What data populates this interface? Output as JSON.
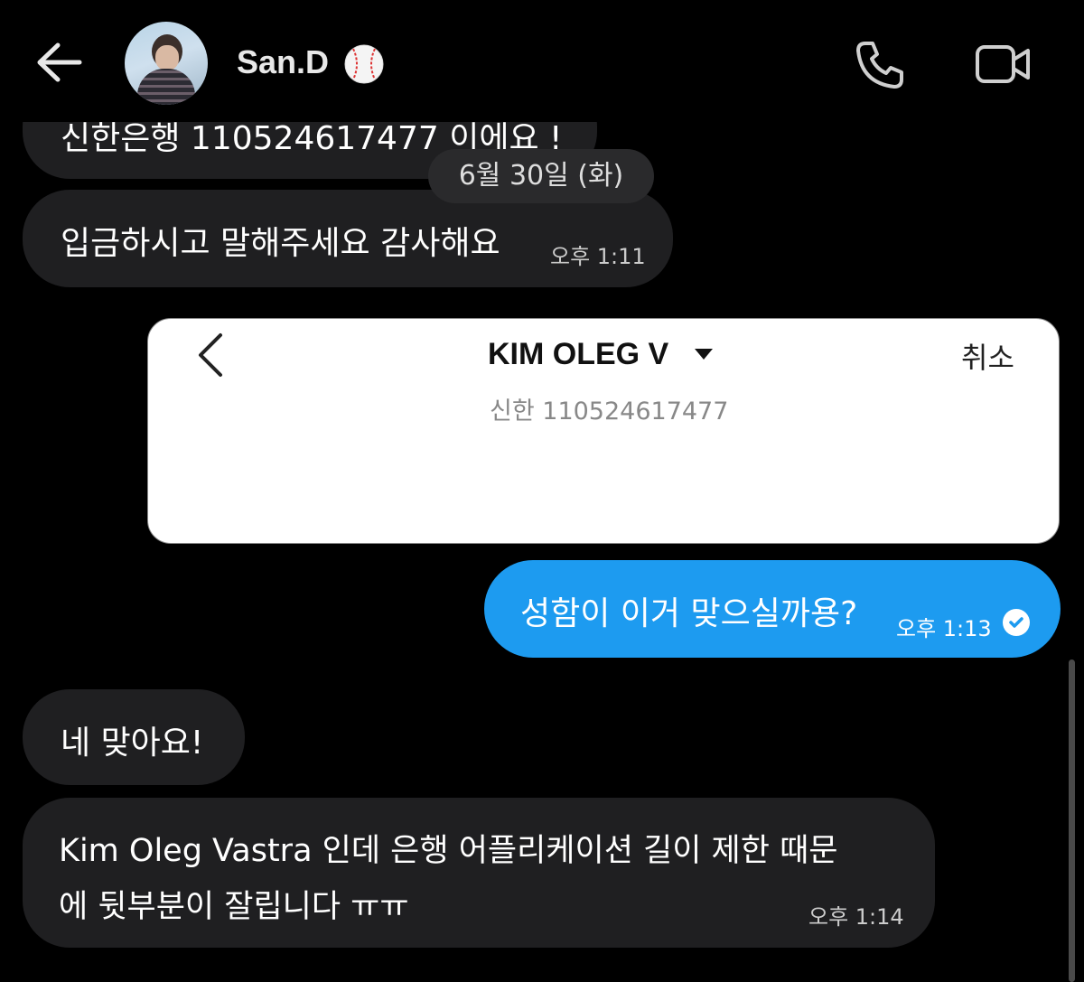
{
  "header": {
    "contact_name": "San.D",
    "icons": [
      "back-arrow-icon",
      "baseball-emoji-icon",
      "phone-icon",
      "video-icon"
    ]
  },
  "messages": [
    {
      "id": "m0",
      "direction": "in",
      "text": "신한은행 110524617477 이에요 !",
      "time": ""
    },
    {
      "id": "m1",
      "direction": "in",
      "text": "입금하시고 말해주세요 감사해요",
      "time": "오후 1:11"
    },
    {
      "id": "m2",
      "direction": "out",
      "text": "성함이 이거 맞으실까용?",
      "time": "오후 1:13",
      "read": true
    },
    {
      "id": "m3",
      "direction": "in",
      "text": "네 맞아요!",
      "time": ""
    },
    {
      "id": "m4",
      "direction": "in",
      "line1": "Kim Oleg Vastra 인데 은행 어플리케이션 길이 제한 때문",
      "line2": "에 뒷부분이 잘립니다 ㅠㅠ",
      "time": "오후 1:14"
    }
  ],
  "date_separator": "6월 30일 (화)",
  "transfer_card": {
    "account_name": "KIM OLEG V",
    "cancel_label": "취소",
    "account_number": "신한 110524617477"
  },
  "colors": {
    "background": "#000000",
    "incoming_bubble": "#1f1f21",
    "outgoing_bubble": "#1d9bf0",
    "card_background": "#ffffff"
  }
}
